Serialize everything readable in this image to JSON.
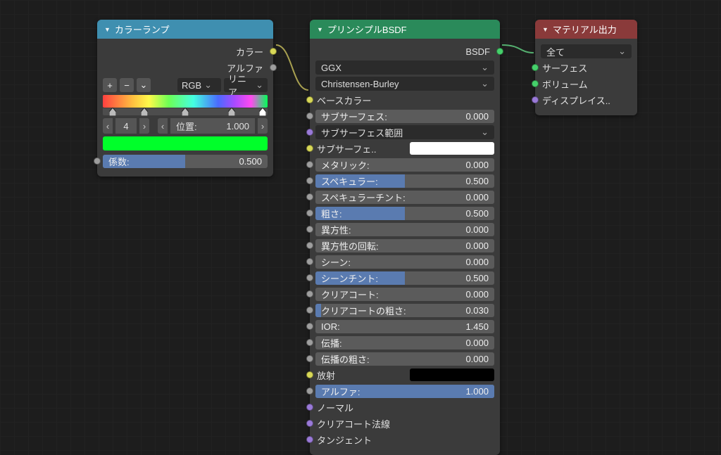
{
  "colorRamp": {
    "title": "カラーランプ",
    "outColor": "カラー",
    "outAlpha": "アルファ",
    "btnAdd": "+",
    "btnRemove": "−",
    "btnMenu": "⌄",
    "modeColor": "RGB",
    "modeInterp": "リニア",
    "stopCount": "4",
    "posLabel": "位置:",
    "posValue": "1.000",
    "facLabel": "係数:",
    "facValue": "0.500",
    "stops": [
      6,
      25,
      50,
      78,
      97
    ]
  },
  "principled": {
    "title": "プリンシプルBSDF",
    "outBSDF": "BSDF",
    "dist": "GGX",
    "sss": "Christensen-Burley",
    "baseColor": "ベースカラー",
    "subsurfRadiusLabel": "サブサーフェス範囲",
    "subsurfColorLabel": "サブサーフェ..",
    "emissionLabel": "放射",
    "normalLabel": "ノーマル",
    "clearcoatNormalLabel": "クリアコート法線",
    "tangentLabel": "タンジェント",
    "subsurfColorSwatch": "#ffffff",
    "emissionSwatch": "#000000",
    "sliders": {
      "subsurface": {
        "label": "サブサーフェス:",
        "value": "0.000",
        "fill": 0
      },
      "metallic": {
        "label": "メタリック:",
        "value": "0.000",
        "fill": 0
      },
      "specular": {
        "label": "スペキュラー:",
        "value": "0.500",
        "fill": 50
      },
      "specTint": {
        "label": "スペキュラーチント:",
        "value": "0.000",
        "fill": 0
      },
      "roughness": {
        "label": "粗さ:",
        "value": "0.500",
        "fill": 50
      },
      "anisotropic": {
        "label": "異方性:",
        "value": "0.000",
        "fill": 0
      },
      "anisoRot": {
        "label": "異方性の回転:",
        "value": "0.000",
        "fill": 0
      },
      "sheen": {
        "label": "シーン:",
        "value": "0.000",
        "fill": 0
      },
      "sheenTint": {
        "label": "シーンチント:",
        "value": "0.500",
        "fill": 50
      },
      "clearcoat": {
        "label": "クリアコート:",
        "value": "0.000",
        "fill": 0
      },
      "clearcoatRough": {
        "label": "クリアコートの粗さ:",
        "value": "0.030",
        "fill": 3
      },
      "ior": {
        "label": "IOR:",
        "value": "1.450",
        "fill": 0
      },
      "transmission": {
        "label": "伝播:",
        "value": "0.000",
        "fill": 0
      },
      "transRough": {
        "label": "伝播の粗さ:",
        "value": "0.000",
        "fill": 0
      },
      "alpha": {
        "label": "アルファ:",
        "value": "1.000",
        "fill": 100
      }
    }
  },
  "output": {
    "title": "マテリアル出力",
    "target": "全て",
    "surface": "サーフェス",
    "volume": "ボリューム",
    "displacement": "ディスプレイス.."
  }
}
